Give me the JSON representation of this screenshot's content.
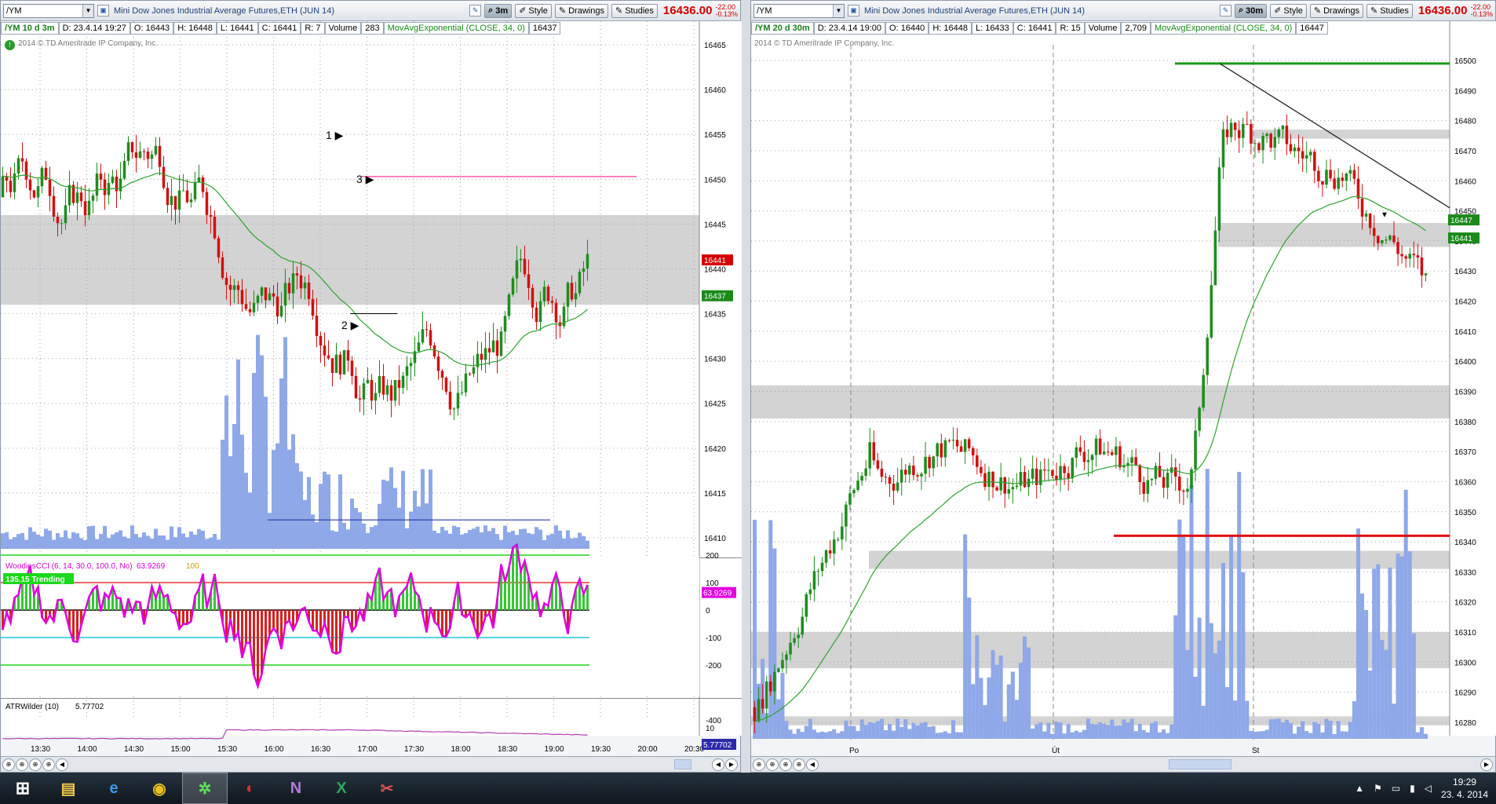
{
  "left_window": {
    "symbol": "/YM",
    "title": "Mini Dow Jones Industrial Average Futures,ETH (JUN 14)",
    "period": "3m",
    "buttons": {
      "style": "Style",
      "drawings": "Drawings",
      "studies": "Studies"
    },
    "last_price": "16436.00",
    "change": "-22.00",
    "change_pct": "-0.13%",
    "info": {
      "symbol": "/YM 10 d 3m",
      "date": "D: 23.4.14 19:27",
      "open": "O: 16443",
      "high": "H: 16448",
      "low": "L: 16441",
      "close": "C: 16441",
      "range": "R: 7",
      "volume_label": "Volume",
      "volume_value": "283",
      "ma_label": "MovAvgExponential (CLOSE, 34, 0)",
      "ma_value": "16437"
    },
    "copyright": "2014 © TD Ameritrade IP Company, Inc.",
    "price_axis": [
      "16465",
      "16460",
      "16455",
      "16450",
      "16445",
      "16440",
      "16435",
      "16430",
      "16425",
      "16420",
      "16415",
      "16410"
    ],
    "price_tags": {
      "last": "16441",
      "ema": "16437"
    },
    "time_axis": [
      "13:30",
      "14:00",
      "14:30",
      "15:00",
      "15:30",
      "16:00",
      "16:30",
      "17:00",
      "17:30",
      "18:00",
      "18:30",
      "19:00",
      "19:30",
      "20:00",
      "20:30"
    ],
    "annotations": [
      "1",
      "2",
      "3"
    ],
    "cci": {
      "label": "WoodiesCCI (6, 14, 30.0, 100.0, No)",
      "value": "63.9269",
      "value2": "100",
      "trend": "135.15 Trending",
      "axis": [
        "200",
        "100",
        "0",
        "-100",
        "-200",
        "-400"
      ],
      "tag": "63.9269"
    },
    "atr": {
      "label": "ATRWilder (10)",
      "value": "5.77702",
      "axis": [
        "10"
      ],
      "tag": "5.77702"
    }
  },
  "right_window": {
    "symbol": "/YM",
    "title": "Mini Dow Jones Industrial Average Futures,ETH (JUN 14)",
    "period": "30m",
    "buttons": {
      "style": "Style",
      "drawings": "Drawings",
      "studies": "Studies"
    },
    "last_price": "16436.00",
    "change": "-22.00",
    "change_pct": "-0.13%",
    "info": {
      "symbol": "/YM 20 d 30m",
      "date": "D: 23.4.14 19:00",
      "open": "O: 16440",
      "high": "H: 16448",
      "low": "L: 16433",
      "close": "C: 16441",
      "range": "R: 15",
      "volume_label": "Volume",
      "volume_value": "2,709",
      "ma_label": "MovAvgExponential (CLOSE, 34, 0)",
      "ma_value": "16447"
    },
    "copyright": "2014 © TD Ameritrade IP Company, Inc.",
    "price_axis": [
      "16500",
      "16490",
      "16480",
      "16470",
      "16460",
      "16450",
      "16440",
      "16430",
      "16420",
      "16410",
      "16400",
      "16390",
      "16380",
      "16370",
      "16360",
      "16350",
      "16340",
      "16330",
      "16320",
      "16310",
      "16300",
      "16290",
      "16280"
    ],
    "price_tags": {
      "ema": "16447",
      "last": "16441"
    },
    "time_axis": [
      "Po",
      "Út",
      "St"
    ]
  },
  "taskbar": {
    "apps": [
      "start",
      "explorer",
      "internet-explorer",
      "chrome",
      "thinkorswim",
      "app-red",
      "onenote",
      "excel",
      "snipping-tool"
    ],
    "time": "19:29",
    "date": "23. 4. 2014"
  },
  "colors": {
    "up": "#1e8c1e",
    "down": "#d01010",
    "volume": "#8ea8e8",
    "zone": "#d3d3d3",
    "ema": "#2ea22e",
    "cci": "#e000e0"
  }
}
